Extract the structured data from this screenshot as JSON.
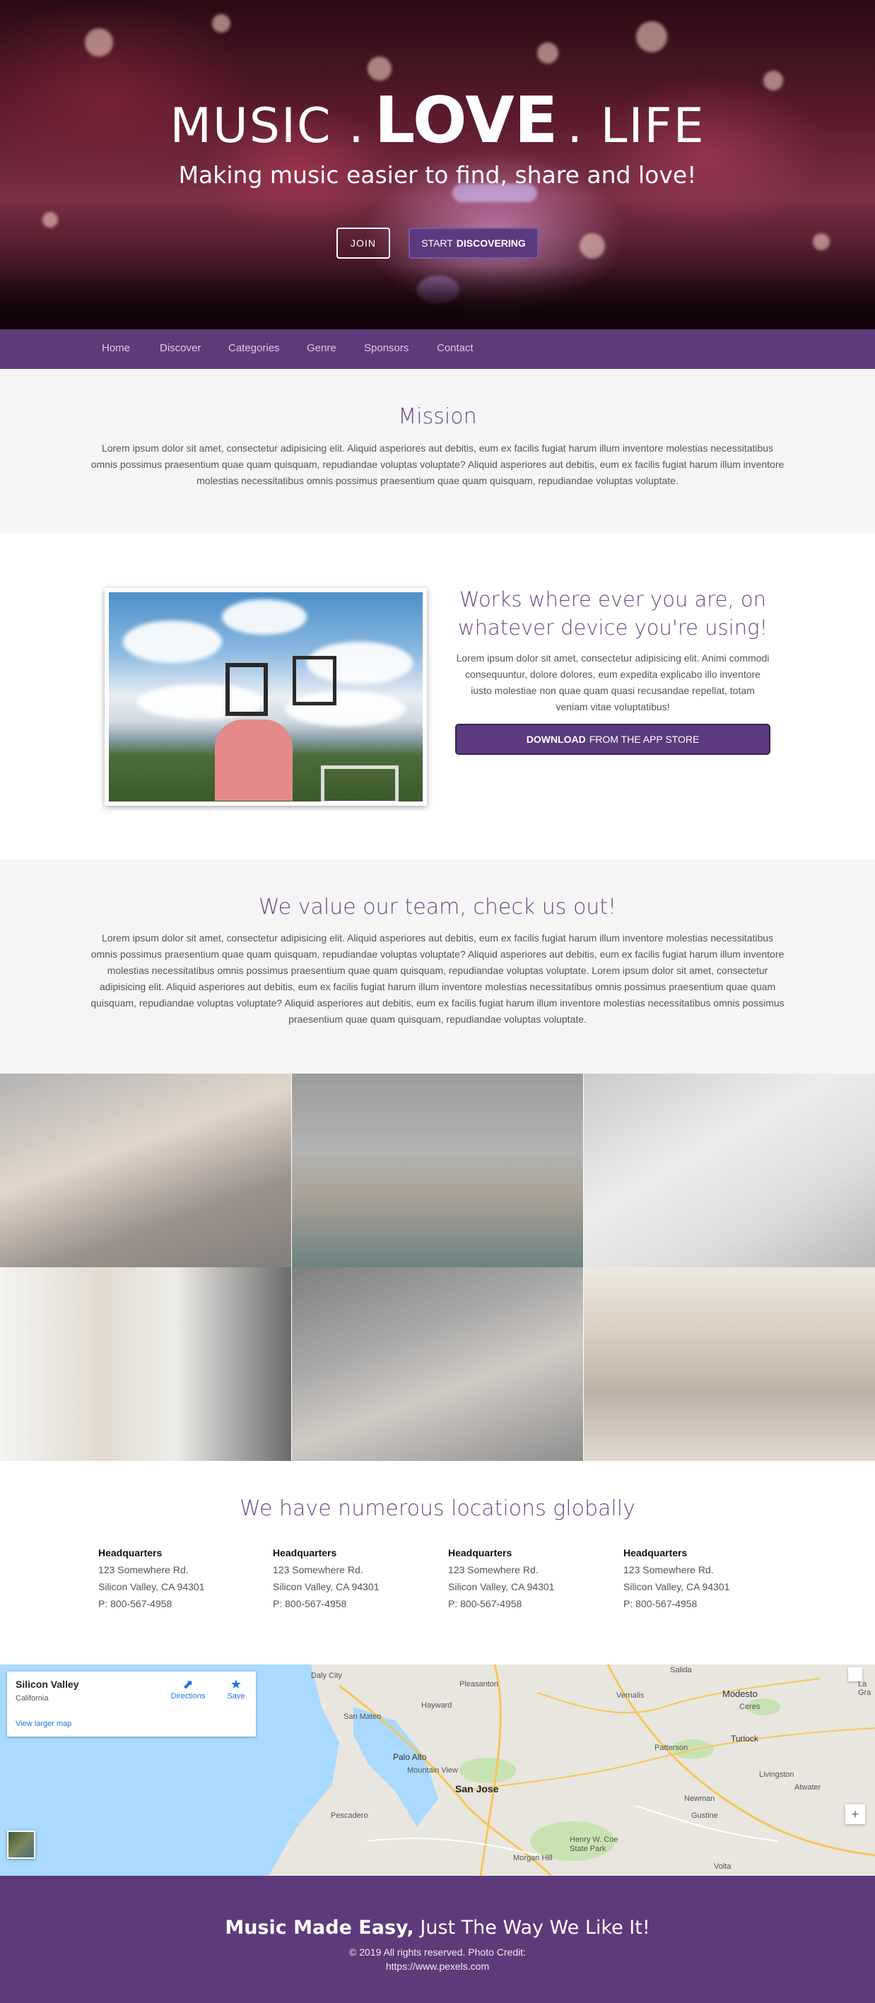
{
  "hero": {
    "title_left": "MUSIC .",
    "title_bold": "LOVE",
    "title_right": ". LIFE",
    "tagline": "Making music easier to find, share and love!",
    "join_label": "JOIN",
    "start_label": "START",
    "start_bold": "DISCOVERING"
  },
  "nav": {
    "items": [
      "Home",
      "Discover",
      "Categories",
      "Genre",
      "Sponsors",
      "Contact"
    ]
  },
  "mission": {
    "title": "Mission",
    "text": "Lorem ipsum dolor sit amet, consectetur adipisicing elit. Aliquid asperiores aut debitis, eum ex facilis fugiat harum illum inventore molestias necessitatibus omnis possimus praesentium quae quam quisquam, repudiandae voluptas voluptate? Aliquid asperiores aut debitis, eum ex facilis fugiat harum illum inventore molestias necessitatibus omnis possimus praesentium quae quam quisquam, repudiandae voluptas voluptate."
  },
  "works": {
    "title": "Works where ever you are, on whatever device you're using!",
    "text": "Lorem ipsum dolor sit amet, consectetur adipisicing elit. Animi commodi consequuntur, dolore dolores, eum expedita explicabo illo inventore iusto molestiae non quae quam quasi recusandae repellat, totam veniam vitae voluptatibus!",
    "btn_bold": "DOWNLOAD",
    "btn_rest": "FROM THE APP STORE"
  },
  "team": {
    "title": "We value our team, check us out!",
    "text": "Lorem ipsum dolor sit amet, consectetur adipisicing elit. Aliquid asperiores aut debitis, eum ex facilis fugiat harum illum inventore molestias necessitatibus omnis possimus praesentium quae quam quisquam, repudiandae voluptas voluptate? Aliquid asperiores aut debitis, eum ex facilis fugiat harum illum inventore molestias necessitatibus omnis possimus praesentium quae quam quisquam, repudiandae voluptas voluptate. Lorem ipsum dolor sit amet, consectetur adipisicing elit. Aliquid asperiores aut debitis, eum ex facilis fugiat harum illum inventore molestias necessitatibus omnis possimus praesentium quae quam quisquam, repudiandae voluptas voluptate? Aliquid asperiores aut debitis, eum ex facilis fugiat harum illum inventore molestias necessitatibus omnis possimus praesentium quae quam quisquam, repudiandae voluptas voluptate."
  },
  "locations": {
    "title": "We have numerous locations globally",
    "items": [
      {
        "name": "Headquarters",
        "street": "123 Somewhere Rd.",
        "city": "Silicon Valley, CA 94301",
        "phone": "P: 800-567-4958"
      },
      {
        "name": "Headquarters",
        "street": "123 Somewhere Rd.",
        "city": "Silicon Valley, CA 94301",
        "phone": "P: 800-567-4958"
      },
      {
        "name": "Headquarters",
        "street": "123 Somewhere Rd.",
        "city": "Silicon Valley, CA 94301",
        "phone": "P: 800-567-4958"
      },
      {
        "name": "Headquarters",
        "street": "123 Somewhere Rd.",
        "city": "Silicon Valley, CA 94301",
        "phone": "P: 800-567-4958"
      }
    ]
  },
  "map": {
    "place_name": "Silicon Valley",
    "place_region": "California",
    "directions_label": "Directions",
    "save_label": "Save",
    "larger_map_label": "View larger map",
    "places": [
      "Daly City",
      "Pleasanton",
      "Salida",
      "Modesto",
      "La Gra",
      "San Mateo",
      "Hayward",
      "Ceres",
      "Turlock",
      "Palo Alto",
      "Mountain View",
      "San Jose",
      "Patterson",
      "Livingston",
      "Atwater",
      "Pescadero",
      "Newman",
      "Gustine",
      "Henry W. Coe State Park",
      "Morgan Hill",
      "Volta",
      "Vernalis"
    ]
  },
  "footer": {
    "head_bold": "Music Made Easy,",
    "head_rest": "Just The Way We Like It!",
    "rights": "© 2019 All rights reserved. Photo Credit:",
    "credit": "https://www.pexels.com"
  },
  "colors": {
    "brand_purple": "#5d3a7a",
    "title_purple": "#6b4a8a",
    "button_purple": "#5b3a7d"
  }
}
